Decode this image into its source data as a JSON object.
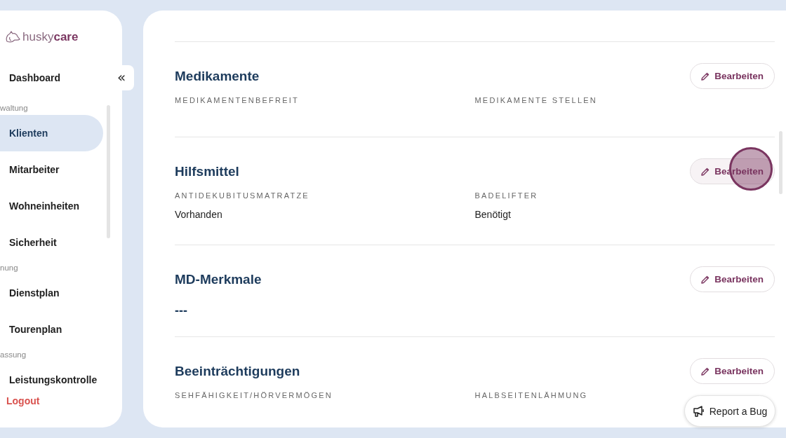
{
  "sidebar": {
    "logo": "husky**care**",
    "collapse_icon": "«",
    "nav": [
      {
        "kind": "item",
        "label": "Dashboard",
        "selected": false
      },
      {
        "kind": "heading",
        "label": "waltung"
      },
      {
        "kind": "item",
        "label": "Klienten",
        "selected": true
      },
      {
        "kind": "item",
        "label": "Mitarbeiter",
        "selected": false
      },
      {
        "kind": "item",
        "label": "Wohneinheiten",
        "selected": false
      },
      {
        "kind": "item",
        "label": "Sicherheit",
        "selected": false
      },
      {
        "kind": "heading",
        "label": "nung"
      },
      {
        "kind": "item",
        "label": "Dienstplan",
        "selected": false
      },
      {
        "kind": "item",
        "label": "Tourenplan",
        "selected": false
      },
      {
        "kind": "heading",
        "label": "assung"
      },
      {
        "kind": "item",
        "label": "Leistungskontrolle",
        "selected": false
      }
    ],
    "logout": "Logout"
  },
  "sections": [
    {
      "title": "Medikamente",
      "button": "Bearbeiten",
      "pressed": false,
      "fields": [
        {
          "label": "MEDIKAMENTENBEFREIT"
        },
        {
          "label": "MEDIKAMENTE STELLEN"
        }
      ]
    },
    {
      "title": "Hilfsmittel",
      "button": "Bearbeiten",
      "pressed": true,
      "fields": [
        {
          "label": "ANTIDEKUBITUSMATRATZE",
          "value": "Vorhanden"
        },
        {
          "label": "BADELIFTER",
          "value": "Benötigt"
        }
      ]
    },
    {
      "title": "MD-Merkmale",
      "button": "Bearbeiten",
      "pressed": false,
      "text": "---"
    },
    {
      "title": "Beeinträchtigungen",
      "button": "Bearbeiten",
      "pressed": false,
      "fields": [
        {
          "label": "SEHFÄHIGKEIT/HÖRVERMÖGEN"
        },
        {
          "label": "HALBSEITENLÄHMUNG"
        }
      ]
    }
  ],
  "report_button": "Report a Bug"
}
